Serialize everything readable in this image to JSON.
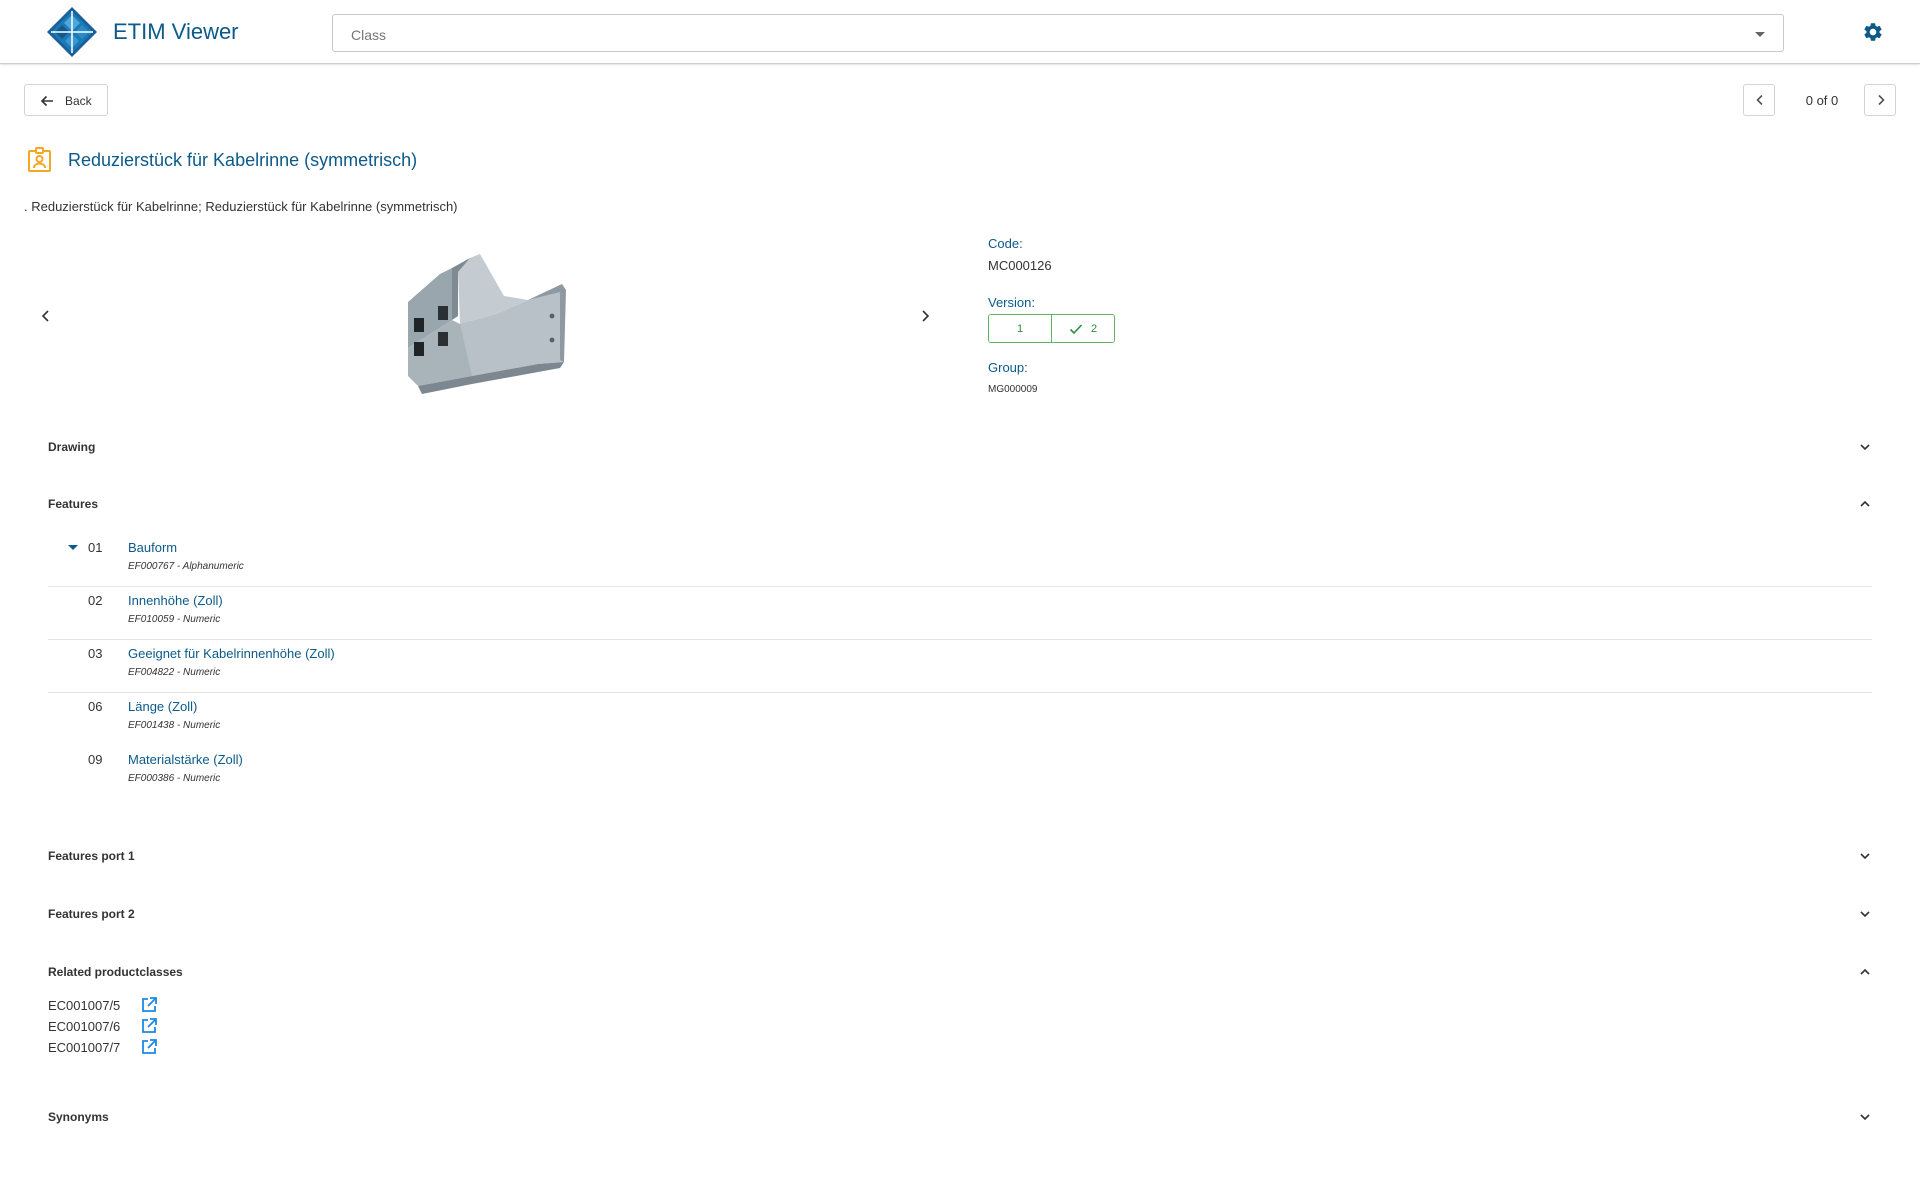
{
  "header": {
    "app_title": "ETIM Viewer",
    "class_placeholder": "Class",
    "logo_icon": "etim-diamond-logo",
    "settings_icon": "gear-icon"
  },
  "toolbar": {
    "back_label": "Back",
    "pager_text": "0 of 0"
  },
  "class": {
    "title": "Reduzierstück für Kabelrinne (symmetrisch)",
    "description": ". Reduzierstück für Kabelrinne; Reduzierstück für Kabelrinne (symmetrisch)",
    "code_label": "Code:",
    "code": "MC000126",
    "version_label": "Version:",
    "versions": [
      {
        "label": "1",
        "selected": false
      },
      {
        "label": "2",
        "selected": true
      }
    ],
    "group_label": "Group:",
    "group": "MG000009"
  },
  "sections": {
    "drawing": "Drawing",
    "features": "Features",
    "features_port_1": "Features port 1",
    "features_port_2": "Features port 2",
    "related": "Related productclasses",
    "synonyms": "Synonyms"
  },
  "features": [
    {
      "num": "01",
      "name": "Bauform",
      "sub": "EF000767 - Alphanumeric"
    },
    {
      "num": "02",
      "name": "Innenhöhe (Zoll)",
      "sub": "EF010059 - Numeric"
    },
    {
      "num": "03",
      "name": "Geeignet für Kabelrinnenhöhe (Zoll)",
      "sub": "EF004822 - Numeric"
    },
    {
      "num": "06",
      "name": "Länge (Zoll)",
      "sub": "EF001438 - Numeric"
    },
    {
      "num": "09",
      "name": "Materialstärke (Zoll)",
      "sub": "EF000386 - Numeric"
    }
  ],
  "related": [
    {
      "code": "EC001007/5"
    },
    {
      "code": "EC001007/6"
    },
    {
      "code": "EC001007/7"
    }
  ],
  "colors": {
    "primary": "#0b5a8a",
    "accent_orange": "#f5a623",
    "version_green": "#2e8b3a",
    "link_blue": "#1e88e5"
  }
}
